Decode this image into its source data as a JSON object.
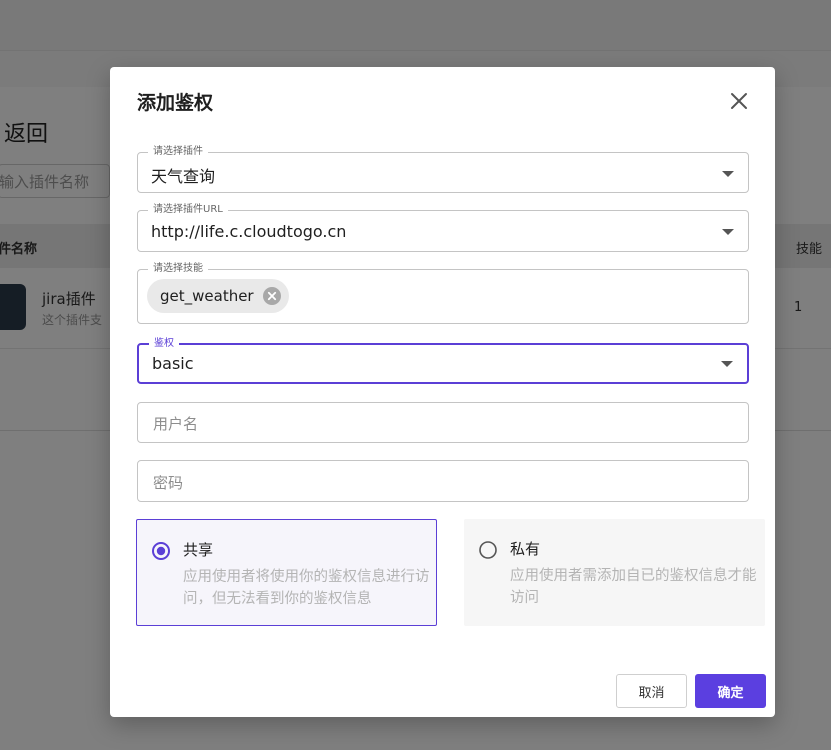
{
  "background": {
    "back_label": "返回",
    "search_placeholder": "输入插件名称",
    "table_header_name": "件名称",
    "table_header_skill": "技能",
    "plugin_name": "jira插件",
    "plugin_desc": "这个插件支",
    "plugin_skill_count": "1"
  },
  "dialog": {
    "title": "添加鉴权",
    "plugin_field": {
      "legend": "请选择插件",
      "value": "天气查询"
    },
    "url_field": {
      "legend": "请选择插件URL",
      "value": "http://life.c.cloudtogo.cn"
    },
    "skill_field": {
      "legend": "请选择技能",
      "chip": "get_weather"
    },
    "auth_field": {
      "legend": "鉴权",
      "value": "basic"
    },
    "username_placeholder": "用户名",
    "password_placeholder": "密码",
    "options": [
      {
        "label": "共享",
        "desc": "应用使用者将使用你的鉴权信息进行访问，但无法看到你的鉴权信息",
        "selected": true
      },
      {
        "label": "私有",
        "desc": "应用使用者需添加自已的鉴权信息才能访问",
        "selected": false
      }
    ],
    "cancel_label": "取消",
    "confirm_label": "确定"
  },
  "colors": {
    "accent": "#5b3fe0",
    "overlay": "rgba(0,0,0,0.5)"
  }
}
